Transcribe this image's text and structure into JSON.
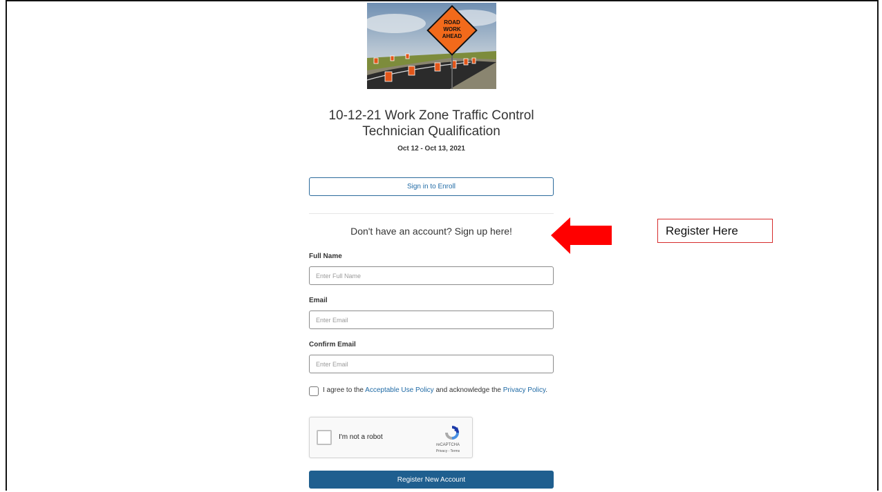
{
  "course": {
    "title": "10-12-21 Work Zone Traffic Control Technician Qualification",
    "dates": "Oct 12 - Oct 13, 2021",
    "hero_sign_lines": [
      "ROAD",
      "WORK",
      "AHEAD"
    ]
  },
  "signin": {
    "label": "Sign in to Enroll"
  },
  "signup": {
    "heading": "Don't have an account? Sign up here!",
    "fields": [
      {
        "label": "Full Name",
        "placeholder": "Enter Full Name",
        "value": ""
      },
      {
        "label": "Email",
        "placeholder": "Enter Email",
        "value": ""
      },
      {
        "label": "Confirm Email",
        "placeholder": "Enter Email",
        "value": ""
      }
    ],
    "agree": {
      "prefix": "I agree to the ",
      "aup_link": "Acceptable Use Policy",
      "middle": " and acknowledge the ",
      "privacy_link": "Privacy Policy",
      "suffix": ".",
      "checked": false
    },
    "recaptcha": {
      "label": "I'm not a robot",
      "brand": "reCAPTCHA",
      "links": "Privacy - Terms"
    },
    "register_label": "Register New Account"
  },
  "annotation": {
    "callout_text": "Register Here",
    "arrow_color": "#ff0000",
    "border_color": "#d62b2b"
  },
  "colors": {
    "primary": "#1f5f8f",
    "link": "#1f6aa5"
  }
}
